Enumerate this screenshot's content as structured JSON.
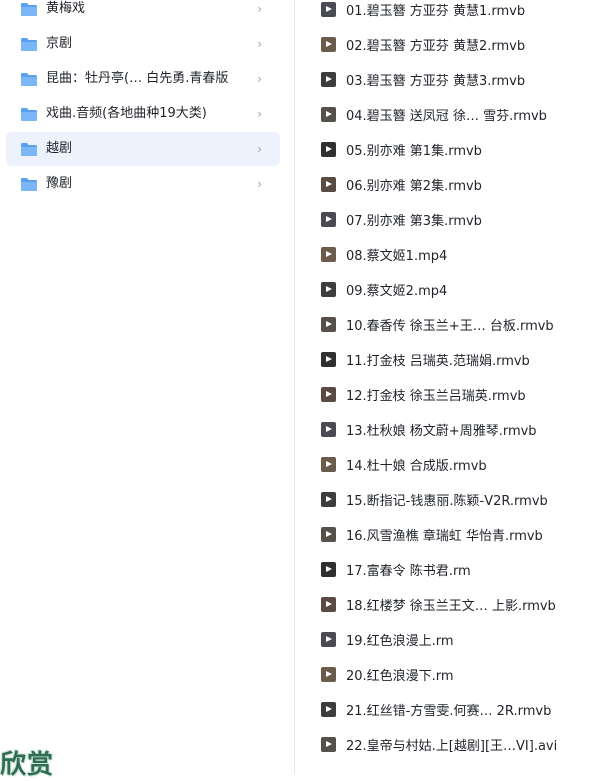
{
  "folders": [
    {
      "label": "黄梅戏",
      "selected": false
    },
    {
      "label": "京剧",
      "selected": false
    },
    {
      "label": "昆曲：牡丹亭(…   白先勇.青春版",
      "selected": false
    },
    {
      "label": "戏曲.音频(各地曲种19大类)",
      "selected": false
    },
    {
      "label": "越剧",
      "selected": true
    },
    {
      "label": "豫剧",
      "selected": false
    }
  ],
  "files": [
    {
      "label": "01.碧玉簪 方亚芬 黄慧1.rmvb"
    },
    {
      "label": "02.碧玉簪 方亚芬 黄慧2.rmvb"
    },
    {
      "label": "03.碧玉簪 方亚芬 黄慧3.rmvb"
    },
    {
      "label": "04.碧玉簪 送凤冠 徐…   雪芬.rmvb"
    },
    {
      "label": "05.别亦难 第1集.rmvb"
    },
    {
      "label": "06.别亦难 第2集.rmvb"
    },
    {
      "label": "07.别亦难 第3集.rmvb"
    },
    {
      "label": "08.蔡文姬1.mp4"
    },
    {
      "label": "09.蔡文姬2.mp4"
    },
    {
      "label": "10.春香传 徐玉兰+王…  台板.rmvb"
    },
    {
      "label": "11.打金枝 吕瑞英.范瑞娟.rmvb"
    },
    {
      "label": "12.打金枝 徐玉兰吕瑞英.rmvb"
    },
    {
      "label": "13.杜秋娘 杨文蔚+周雅琴.rmvb"
    },
    {
      "label": "14.杜十娘 合成版.rmvb"
    },
    {
      "label": "15.断指记-钱惠丽.陈颖-V2R.rmvb"
    },
    {
      "label": "16.风雪渔樵 章瑞虹 华怡青.rmvb"
    },
    {
      "label": "17.富春令 陈书君.rm"
    },
    {
      "label": "18.红楼梦 徐玉兰王文… 上影.rmvb"
    },
    {
      "label": "19.红色浪漫上.rm"
    },
    {
      "label": "20.红色浪漫下.rm"
    },
    {
      "label": "21.红丝错-方雪雯.何赛…  2R.rmvb"
    },
    {
      "label": "22.皇帝与村姑.上[越剧][王…VI].avi"
    }
  ],
  "watermark": "欣赏",
  "icons": {
    "folder": "folder-icon",
    "chevron": "chevron-right-icon",
    "video_thumb": "video-thumbnail-icon"
  },
  "colors": {
    "folder_fill": "#5aa0f0",
    "selected_bg": "#edf2fd",
    "text": "#1f2329",
    "chevron": "#9aa0a8"
  }
}
